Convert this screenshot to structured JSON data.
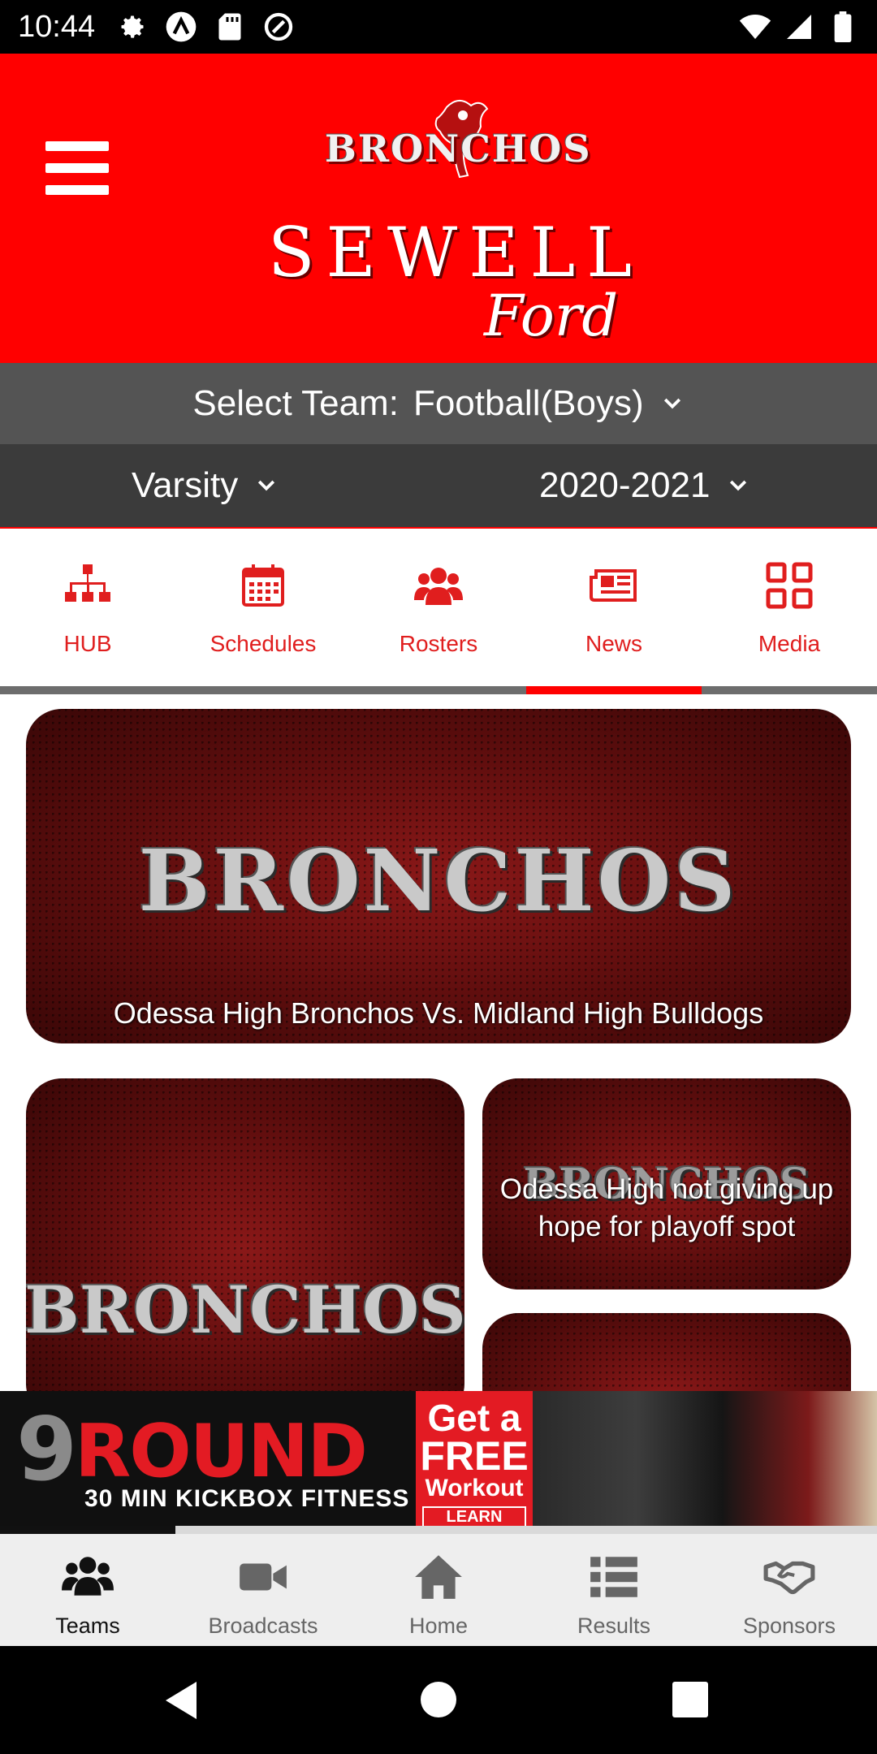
{
  "status_bar": {
    "time": "10:44",
    "left_icons": [
      "settings-icon",
      "app-icon",
      "sd-card-icon",
      "sync-icon"
    ],
    "right_icons": [
      "wifi-icon",
      "signal-icon",
      "battery-icon"
    ]
  },
  "header": {
    "logo_top": "BRONCHOS",
    "logo_main": "SEWELL",
    "logo_sub": "Ford",
    "background_color": "#ff0000"
  },
  "team_select": {
    "label": "Select Team:",
    "value": "Football(Boys)"
  },
  "filters": {
    "level": "Varsity",
    "season": "2020-2021"
  },
  "tabs": [
    {
      "label": "HUB",
      "icon": "org-chart-icon"
    },
    {
      "label": "Schedules",
      "icon": "calendar-icon"
    },
    {
      "label": "Rosters",
      "icon": "users-icon"
    },
    {
      "label": "News",
      "icon": "newspaper-icon",
      "active": true
    },
    {
      "label": "Media",
      "icon": "grid-icon"
    }
  ],
  "news_cards": [
    {
      "image_word": "BRONCHOS",
      "title": "Odessa High Bronchos Vs. Midland High Bulldogs"
    },
    {
      "image_word": "BRONCHOS",
      "title": ""
    },
    {
      "image_word": "BRONCHOS",
      "title": "Odessa High not giving up hope for playoff spot"
    },
    {
      "image_word": "",
      "title": ""
    }
  ],
  "ad": {
    "brand_number": "9",
    "brand_word": "ROUND",
    "tagline": "30 MIN KICKBOX FITNESS",
    "cta_line1": "Get a",
    "cta_line2": "FREE",
    "cta_line3": "Workout",
    "cta_button": "LEARN MORE",
    "progress": 0.2
  },
  "bottom_nav": [
    {
      "label": "Teams",
      "icon": "users-icon",
      "active": true
    },
    {
      "label": "Broadcasts",
      "icon": "video-camera-icon"
    },
    {
      "label": "Home",
      "icon": "home-icon"
    },
    {
      "label": "Results",
      "icon": "list-icon"
    },
    {
      "label": "Sponsors",
      "icon": "handshake-icon"
    }
  ],
  "colors": {
    "brand_red": "#ff0000",
    "tab_red": "#e01e1e",
    "team_bar": "#545454",
    "filter_bar": "#3b3b3b"
  }
}
